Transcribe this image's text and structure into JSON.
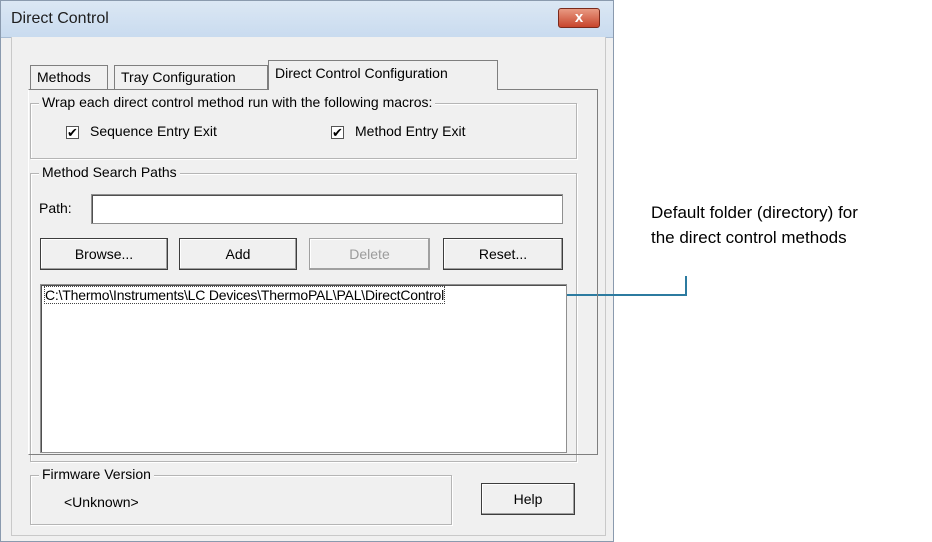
{
  "window": {
    "title": "Direct Control",
    "close_glyph": "x"
  },
  "tabs": [
    {
      "label": "Methods"
    },
    {
      "label": "Tray Configuration"
    },
    {
      "label": "Direct Control Configuration"
    }
  ],
  "wrap_group": {
    "legend": "Wrap each direct control method run with the following macros:",
    "sequence_checkbox": {
      "label": "Sequence Entry Exit",
      "checked": true,
      "mark": "✔"
    },
    "method_checkbox": {
      "label": "Method Entry Exit",
      "checked": true,
      "mark": "✔"
    }
  },
  "search_paths_group": {
    "legend": "Method Search Paths",
    "path_label": "Path:",
    "path_value": "",
    "buttons": {
      "browse": "Browse...",
      "add": "Add",
      "delete": "Delete",
      "reset": "Reset..."
    },
    "paths": [
      "C:\\Thermo\\Instruments\\LC Devices\\ThermoPAL\\PAL\\DirectControl"
    ]
  },
  "firmware_group": {
    "legend": "Firmware Version",
    "value": "<Unknown>"
  },
  "help_button": "Help",
  "annotation": {
    "line1": "Default folder (directory) for",
    "line2": "the direct control methods",
    "color": "#2c7ba0"
  }
}
